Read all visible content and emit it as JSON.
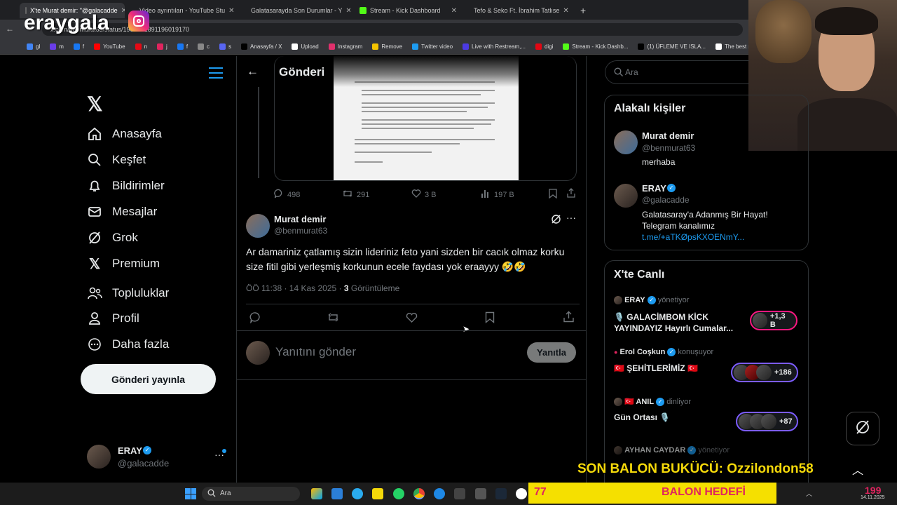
{
  "browser": {
    "tabs": [
      {
        "label": "X'te Murat demir: \"@galacadde",
        "active": true,
        "color": "#000000"
      },
      {
        "label": "Video ayrıntıları - YouTube Stu",
        "active": false,
        "color": "#ff0000"
      },
      {
        "label": "Galatasarayda Son Durumlar - Y",
        "active": false,
        "color": "#ff0000"
      },
      {
        "label": "Stream - Kick Dashboard",
        "active": false,
        "color": "#53fc18"
      },
      {
        "label": "Tefo & Seko Ft. İbrahim Tatlıse",
        "active": false,
        "color": "#ff0000"
      }
    ],
    "new_tab": "+",
    "url": "x.com/benmurat63/status/1989281891196019170",
    "bookmarks": [
      {
        "label": "gl",
        "color": "#4285f4"
      },
      {
        "label": "m",
        "color": "#6a3de8"
      },
      {
        "label": "f",
        "color": "#1877f2"
      },
      {
        "label": "YouTube",
        "color": "#ff0000"
      },
      {
        "label": "n",
        "color": "#e50914"
      },
      {
        "label": "j",
        "color": "#e0245e"
      },
      {
        "label": "f",
        "color": "#1877f2"
      },
      {
        "label": "c",
        "color": "#888888"
      },
      {
        "label": "s",
        "color": "#5865f2"
      },
      {
        "label": "Anasayfa / X",
        "color": "#000000"
      },
      {
        "label": "Upload",
        "color": "#ffffff"
      },
      {
        "label": "Instagram",
        "color": "#e1306c"
      },
      {
        "label": "Remove",
        "color": "#f5c400"
      },
      {
        "label": "Twitter video",
        "color": "#1d9bf0"
      },
      {
        "label": "Live with Restream,...",
        "color": "#4c3ae3"
      },
      {
        "label": "digi",
        "color": "#e30613"
      },
      {
        "label": "Stream - Kick Dashb...",
        "color": "#53fc18"
      },
      {
        "label": "(1) ÜFLEME VE ISLA...",
        "color": "#000000"
      },
      {
        "label": "The best streaming...",
        "color": "#ffffff"
      }
    ]
  },
  "overlay": {
    "watermark": "eraygala",
    "bottom_banner": "SON BALON BUKÜCÜ: Ozzilondon58",
    "goal_label": "BALON HEDEFİ",
    "goal_value": "77",
    "goal_count": "199"
  },
  "sidebar": {
    "items": [
      {
        "label": "Anasayfa",
        "icon": "home-icon"
      },
      {
        "label": "Keşfet",
        "icon": "search-icon"
      },
      {
        "label": "Bildirimler",
        "icon": "bell-icon"
      },
      {
        "label": "Mesajlar",
        "icon": "mail-icon"
      },
      {
        "label": "Grok",
        "icon": "grok-icon"
      },
      {
        "label": "Premium",
        "icon": "x-logo-icon"
      },
      {
        "label": "Topluluklar",
        "icon": "people-icon"
      },
      {
        "label": "Profil",
        "icon": "user-icon"
      },
      {
        "label": "Daha fazla",
        "icon": "more-circle-icon"
      }
    ],
    "post_button": "Gönderi yayınla",
    "account": {
      "name": "ERAY",
      "handle": "@galacadde",
      "more": "···"
    }
  },
  "main": {
    "header_title": "Gönderi",
    "quoted_stats": {
      "replies": "498",
      "reposts": "291",
      "likes": "3 B",
      "views": "197 B"
    },
    "tweet": {
      "author": "Murat demir",
      "handle": "@benmurat63",
      "more": "···",
      "text": "Ar damariniz çatlamış sizin lideriniz feto yani sizden bir cacık olmaz korku size fitil gibi yerleşmiş korkunun ecele faydası yok eraayyy 🤣🤣",
      "time": "ÖÖ 11:38 · 14 Kas 2025 · ",
      "views_count": "3",
      "views_label": "Görüntüleme"
    },
    "reply": {
      "placeholder": "Yanıtını gönder",
      "button": "Yanıtla"
    }
  },
  "right": {
    "search_placeholder": "Ara",
    "relevant_title": "Alakalı kişiler",
    "people": [
      {
        "name": "Murat demir",
        "handle": "@benmurat63",
        "bio": "merhaba",
        "link": ""
      },
      {
        "name": "ERAY",
        "handle": "@galacadde",
        "bio": "Galatasaray'a Adanmış Bir Hayat! Telegram kanalımız",
        "link": "t.me/+aTKØpsKXOENmY..."
      }
    ],
    "live_title": "X'te Canlı",
    "live": [
      {
        "host": "ERAY",
        "status": "yönetiyor",
        "title": "🎙️ GALACİMBOM KİCK YAYINDAYIZ Hayırlı Cumalar...",
        "count": "+1,3 B"
      },
      {
        "host": "Erol Coşkun",
        "status": "konuşuyor",
        "title": "🇹🇷 ŞEHİTLERİMİZ 🇹🇷",
        "count": "+186"
      },
      {
        "host": "🇹🇷 ANIL",
        "status": "dinliyor",
        "title": "Gün Ortası 🎙️",
        "count": "+87"
      },
      {
        "host": "AYHAN CAYDAR",
        "status": "yönetiyor",
        "title": "",
        "count": ""
      }
    ]
  },
  "taskbar": {
    "search": "Ara",
    "date": "14.11.2025"
  }
}
